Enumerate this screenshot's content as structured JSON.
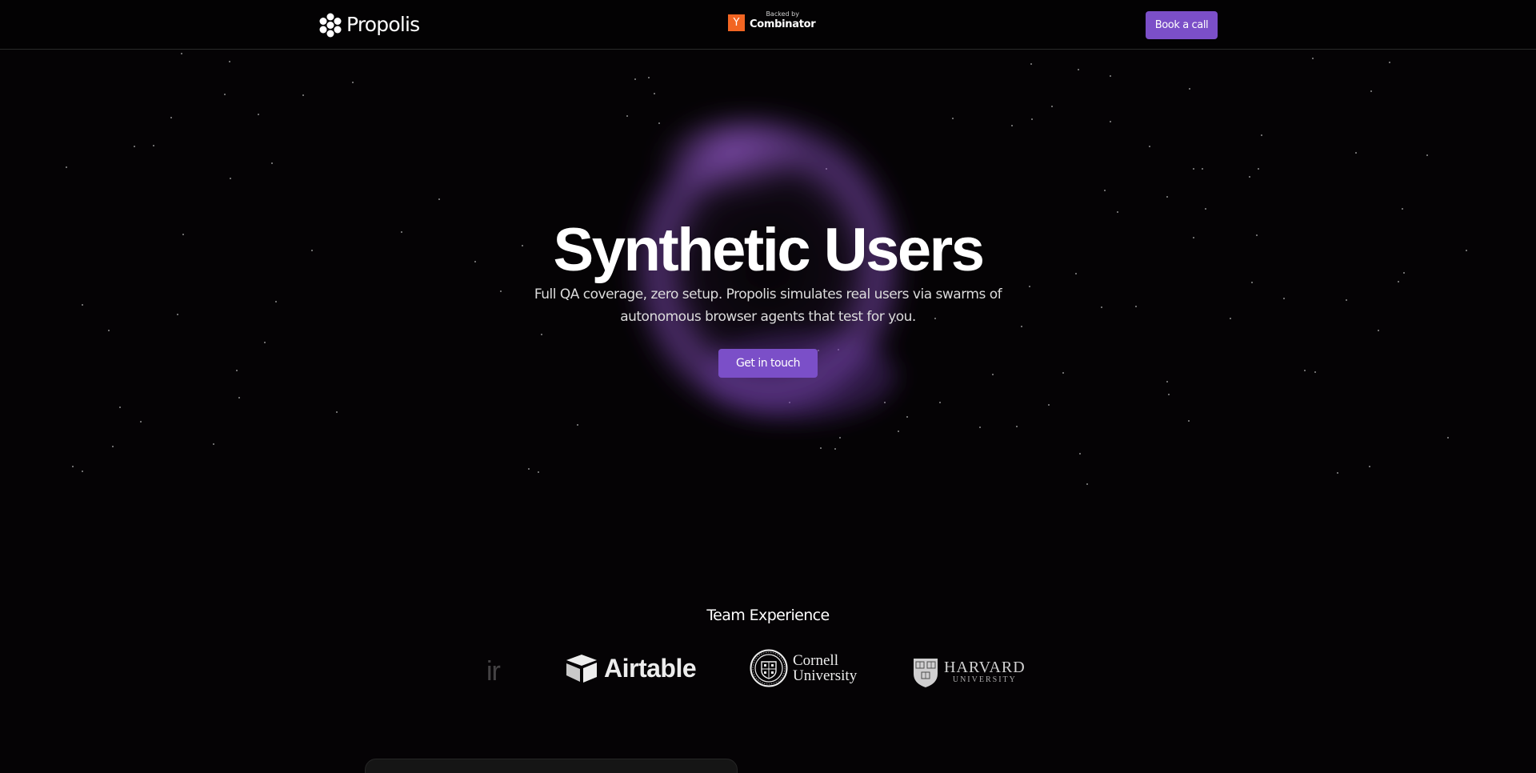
{
  "header": {
    "logo_text": "Propolis",
    "backer_small": "Backed by",
    "backer_letter": "Y",
    "backer_name": "Combinator",
    "book_call_label": "Book a call"
  },
  "hero": {
    "title": "Synthetic Users",
    "subtitle": "Full QA coverage, zero setup. Propolis simulates real users via swarms of autonomous browser agents that test for you.",
    "cta_label": "Get in touch"
  },
  "team": {
    "heading": "Team Experience",
    "partial_logo_text": "ir",
    "airtable_text": "Airtable",
    "cornell_line1": "Cornell",
    "cornell_line2": "University",
    "harvard_line1": "HARVARD",
    "harvard_line2": "UNIVERSITY"
  },
  "colors": {
    "background": "#050305",
    "accent_purple": "#7b4fc8",
    "yc_orange": "#f26522",
    "glow_purple": "#8a4fc0"
  },
  "icons": [
    "propolis-hexagon-logo-icon",
    "y-combinator-icon",
    "airtable-icon",
    "cornell-seal-icon",
    "harvard-shield-icon"
  ]
}
